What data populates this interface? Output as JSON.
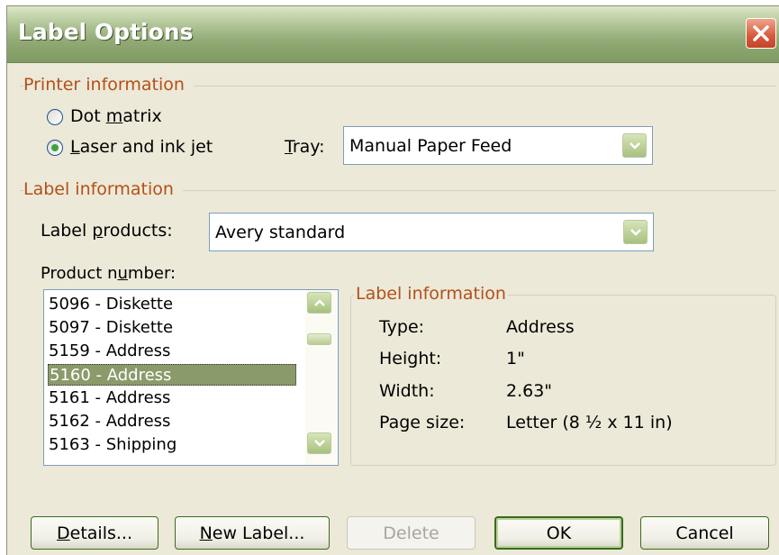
{
  "window": {
    "title": "Label Options",
    "close_icon": "close-icon"
  },
  "printer_information": {
    "heading": "Printer information",
    "options": [
      {
        "pre": "Dot ",
        "accel": "m",
        "post": "atrix",
        "selected": false
      },
      {
        "pre": "",
        "accel": "L",
        "post": "aser and ink jet",
        "selected": true
      }
    ],
    "tray": {
      "accel": "T",
      "rest": "ray:",
      "value": "Manual Paper Feed"
    }
  },
  "label_information": {
    "heading": "Label information",
    "products": {
      "pre": "Label ",
      "accel": "p",
      "post": "roducts:",
      "value": "Avery standard"
    },
    "product_number": {
      "pre": "Product n",
      "accel": "u",
      "post": "mber:"
    },
    "product_list": [
      "5096 - Diskette",
      "5097 - Diskette",
      "5159 - Address",
      "5160 - Address",
      "5161 - Address",
      "5162 - Address",
      "5163 - Shipping"
    ],
    "selected_product": "5160 - Address"
  },
  "details": {
    "heading": "Label information",
    "rows": [
      {
        "label": "Type:",
        "value": "Address"
      },
      {
        "label": "Height:",
        "value": "1\""
      },
      {
        "label": "Width:",
        "value": "2.63\""
      },
      {
        "label": "Page size:",
        "value": "Letter (8 ½ x 11 in)"
      }
    ]
  },
  "buttons": {
    "details": {
      "accel": "D",
      "rest": "etails..."
    },
    "new_label": {
      "accel": "N",
      "rest": "ew Label..."
    },
    "delete": "Delete",
    "ok": "OK",
    "cancel": "Cancel"
  }
}
